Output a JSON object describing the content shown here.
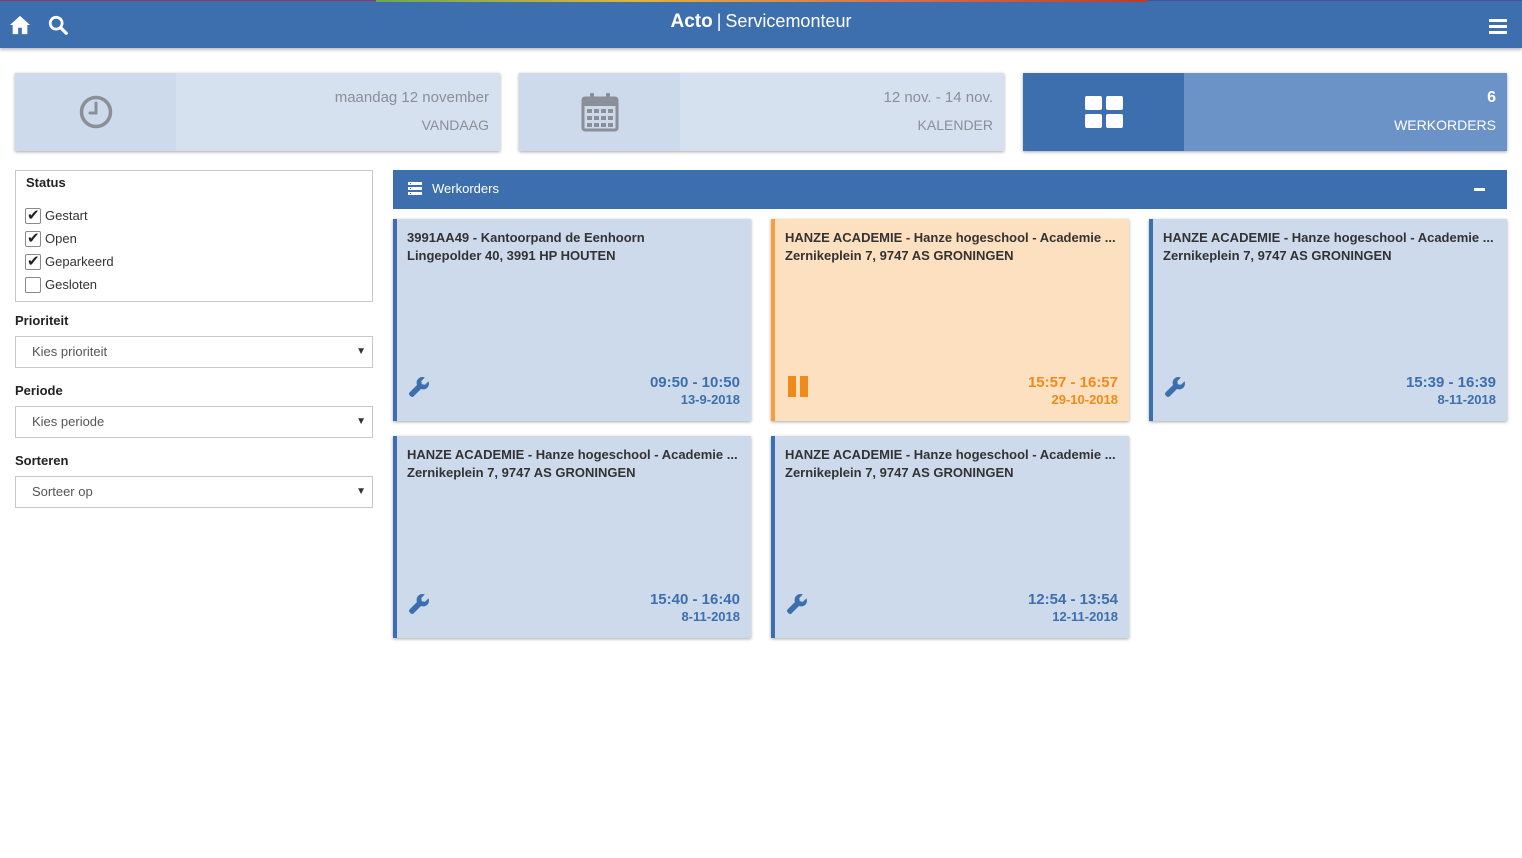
{
  "header": {
    "brand_name": "Acto",
    "separator": "|",
    "brand_sub": "Servicemonteur",
    "accent_color": "#3d6fae"
  },
  "tiles": [
    {
      "icon": "clock-icon",
      "big": "maandag 12 november",
      "small": "VANDAAG"
    },
    {
      "icon": "calendar-icon",
      "big": "12 nov. - 14 nov.",
      "small": "KALENDER"
    },
    {
      "icon": "grid-icon",
      "big": "6",
      "small": "WERKORDERS"
    }
  ],
  "filters": {
    "status_title": "Status",
    "status_options": [
      {
        "label": "Gestart",
        "checked": true
      },
      {
        "label": "Open",
        "checked": true
      },
      {
        "label": "Geparkeerd",
        "checked": true
      },
      {
        "label": "Gesloten",
        "checked": false
      }
    ],
    "priority_label": "Prioriteit",
    "priority_value": "Kies prioriteit",
    "period_label": "Periode",
    "period_value": "Kies periode",
    "sort_label": "Sorteren",
    "sort_value": "Sorteer op"
  },
  "panel": {
    "title": "Werkorders",
    "collapse_icon": "minus-icon"
  },
  "workorders": [
    {
      "line1": "3991AA49 - Kantoorpand de Eenhoorn",
      "line2": "Lingepolder 40, 3991 HP HOUTEN",
      "time": "09:50 - 10:50",
      "date": "13-9-2018",
      "status_icon": "wrench-icon"
    },
    {
      "line1": "HANZE ACADEMIE - Hanze hogeschool - Academie ...",
      "line2": "Zernikeplein 7, 9747 AS GRONINGEN",
      "time": "15:57 - 16:57",
      "date": "29-10-2018",
      "status_icon": "pause-icon"
    },
    {
      "line1": "HANZE ACADEMIE - Hanze hogeschool - Academie ...",
      "line2": "Zernikeplein 7, 9747 AS GRONINGEN",
      "time": "15:39 - 16:39",
      "date": "8-11-2018",
      "status_icon": "wrench-icon"
    },
    {
      "line1": "HANZE ACADEMIE - Hanze hogeschool - Academie ...",
      "line2": "Zernikeplein 7, 9747 AS GRONINGEN",
      "time": "15:40 - 16:40",
      "date": "8-11-2018",
      "status_icon": "wrench-icon"
    },
    {
      "line1": "HANZE ACADEMIE - Hanze hogeschool - Academie ...",
      "line2": "Zernikeplein 7, 9747 AS GRONINGEN",
      "time": "12:54 - 13:54",
      "date": "12-11-2018",
      "status_icon": "wrench-icon"
    }
  ]
}
